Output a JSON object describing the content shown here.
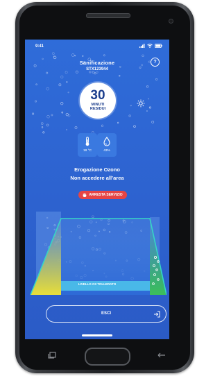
{
  "status": {
    "time": "9:41"
  },
  "header": {
    "title": "Sanificazione",
    "subtitle": "STX123944",
    "help_symbol": "?"
  },
  "timer": {
    "value": "30",
    "unit": "MINUTI",
    "label": "RESIDUI"
  },
  "stats": [
    {
      "icon": "thermometer-icon",
      "value": "18 °C"
    },
    {
      "icon": "water-drop-icon",
      "value": "43%"
    }
  ],
  "message": {
    "line1": "Erogazione Ozono",
    "line2": "Non accedere all’area"
  },
  "stop_button": {
    "label": "ARRESTA SERVIZIO",
    "icon": "hand-icon"
  },
  "level": {
    "label": "LIVELLO O3 TOLLERATO"
  },
  "exit_button": {
    "label": "ESCI",
    "icon": "logout-icon"
  },
  "colors": {
    "screen_bg": "#2f6cd9",
    "stop_button": "#e64545",
    "level_band": "#49b8e8",
    "yellow": "#e8de3a",
    "green": "#3cbf5a"
  }
}
